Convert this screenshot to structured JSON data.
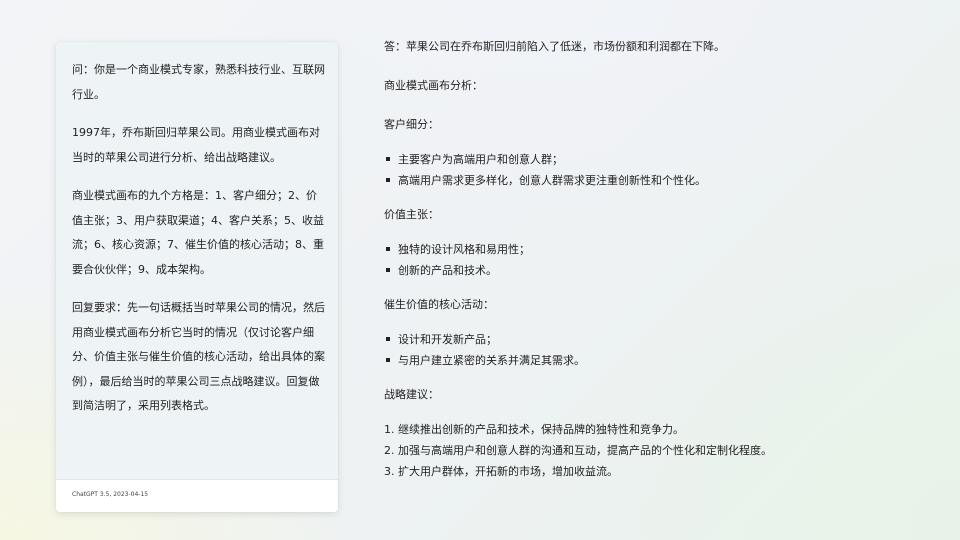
{
  "question_card": {
    "paragraphs": [
      "问：你是一个商业模式专家，熟悉科技行业、互联网行业。",
      "1997年，乔布斯回归苹果公司。用商业模式画布对当时的苹果公司进行分析、给出战略建议。",
      "商业模式画布的九个方格是：1、客户细分；2、价值主张；3、用户获取渠道；4、客户关系；5、收益流；6、核心资源；7、催生价值的核心活动；8、重要合伙伙伴；9、成本架构。",
      "回复要求：先一句话概括当时苹果公司的情况，然后用商业模式画布分析它当时的情况（仅讨论客户细分、价值主张与催生价值的核心活动，给出具体的案例），最后给当时的苹果公司三点战略建议。回复做到简洁明了，采用列表格式。"
    ],
    "footer": "ChatGPT 3.5, 2023-04-15"
  },
  "answer": {
    "summary": "答：苹果公司在乔布斯回归前陷入了低迷，市场份额和利润都在下降。",
    "canvas_heading": "商业模式画布分析：",
    "customer_heading": "客户细分：",
    "customer_items": [
      "主要客户为高端用户和创意人群；",
      "高端用户需求更多样化，创意人群需求更注重创新性和个性化。"
    ],
    "value_heading": "价值主张：",
    "value_items": [
      "独特的设计风格和易用性；",
      "创新的产品和技术。"
    ],
    "activity_heading": "催生价值的核心活动：",
    "activity_items": [
      "设计和开发新产品；",
      "与用户建立紧密的关系并满足其需求。"
    ],
    "strategy_heading": "战略建议：",
    "strategy_items": [
      "继续推出创新的产品和技术，保持品牌的独特性和竞争力。",
      "加强与高端用户和创意人群的沟通和互动，提高产品的个性化和定制化程度。",
      "扩大用户群体，开拓新的市场，增加收益流。"
    ]
  }
}
